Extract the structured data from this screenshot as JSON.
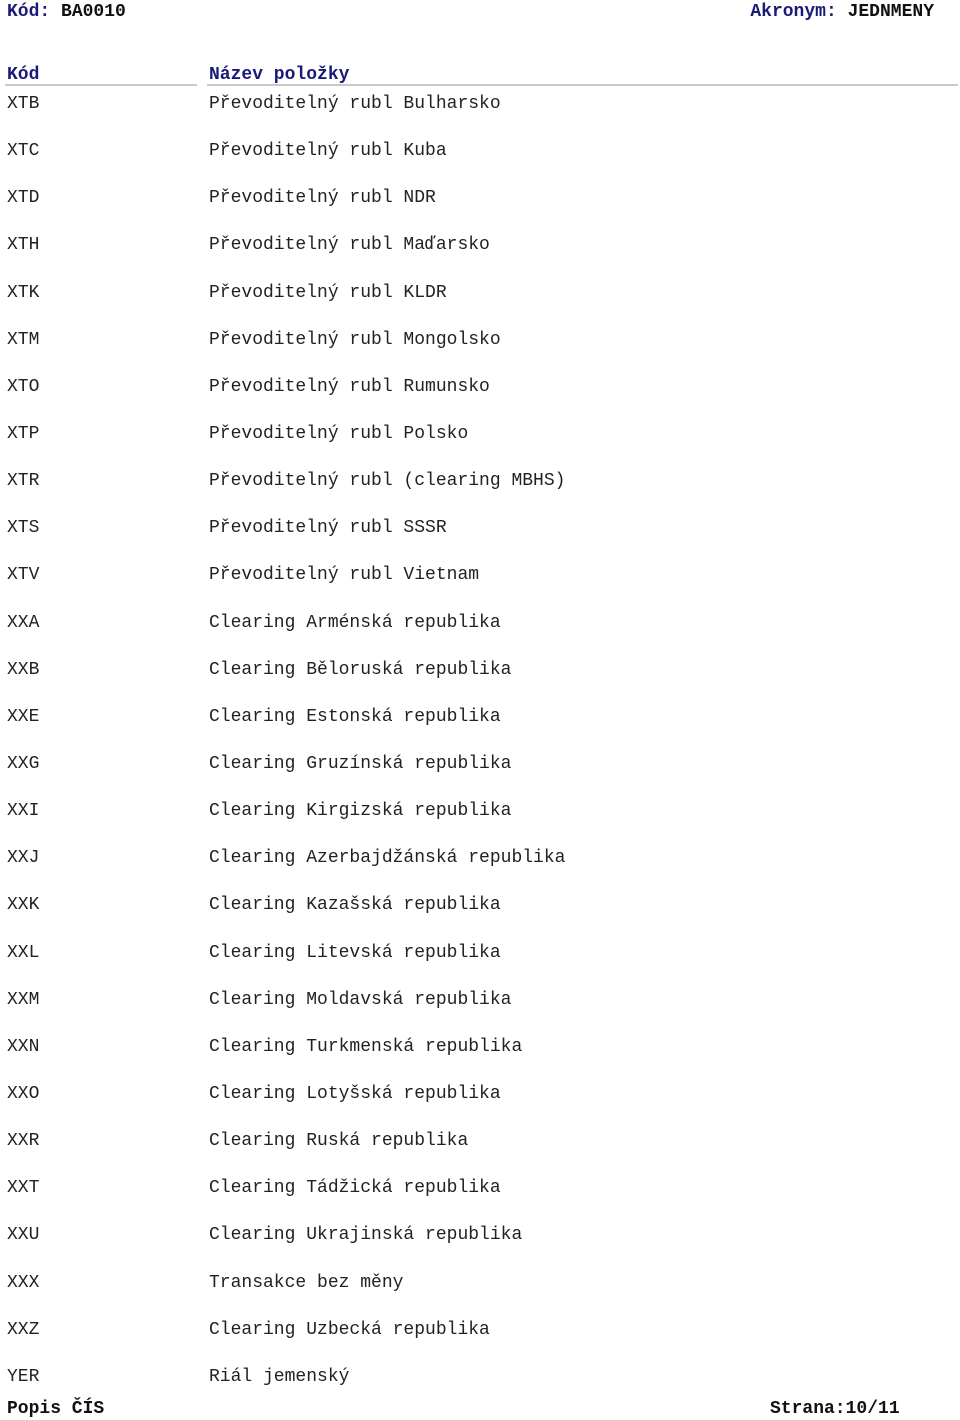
{
  "header": {
    "code_label": "Kód:",
    "code_value": "BA0010",
    "acronym_label": "Akronym:",
    "acronym_value": "JEDNMENY"
  },
  "columns": {
    "code": "Kód",
    "name": "Název položky"
  },
  "rows": [
    {
      "code": "XTB",
      "name": "Převoditelný rubl Bulharsko"
    },
    {
      "code": "XTC",
      "name": "Převoditelný rubl Kuba"
    },
    {
      "code": "XTD",
      "name": "Převoditelný rubl NDR"
    },
    {
      "code": "XTH",
      "name": "Převoditelný rubl Maďarsko"
    },
    {
      "code": "XTK",
      "name": "Převoditelný rubl KLDR"
    },
    {
      "code": "XTM",
      "name": "Převoditelný rubl Mongolsko"
    },
    {
      "code": "XTO",
      "name": "Převoditelný rubl Rumunsko"
    },
    {
      "code": "XTP",
      "name": "Převoditelný rubl Polsko"
    },
    {
      "code": "XTR",
      "name": "Převoditelný rubl (clearing MBHS)"
    },
    {
      "code": "XTS",
      "name": "Převoditelný rubl SSSR"
    },
    {
      "code": "XTV",
      "name": "Převoditelný rubl Vietnam"
    },
    {
      "code": "XXA",
      "name": "Clearing Arménská republika"
    },
    {
      "code": "XXB",
      "name": "Clearing Běloruská republika"
    },
    {
      "code": "XXE",
      "name": "Clearing Estonská republika"
    },
    {
      "code": "XXG",
      "name": "Clearing Gruzínská republika"
    },
    {
      "code": "XXI",
      "name": "Clearing Kirgizská republika"
    },
    {
      "code": "XXJ",
      "name": "Clearing Azerbajdžánská republika"
    },
    {
      "code": "XXK",
      "name": "Clearing Kazašská republika"
    },
    {
      "code": "XXL",
      "name": "Clearing Litevská republika"
    },
    {
      "code": "XXM",
      "name": "Clearing Moldavská republika"
    },
    {
      "code": "XXN",
      "name": "Clearing Turkmenská republika"
    },
    {
      "code": "XXO",
      "name": "Clearing Lotyšská republika"
    },
    {
      "code": "XXR",
      "name": "Clearing Ruská republika"
    },
    {
      "code": "XXT",
      "name": "Clearing Tádžická republika"
    },
    {
      "code": "XXU",
      "name": "Clearing Ukrajinská republika"
    },
    {
      "code": "XXX",
      "name": "Transakce bez měny"
    },
    {
      "code": "XXZ",
      "name": "Clearing Uzbecká republika"
    },
    {
      "code": "YER",
      "name": "Riál jemenský"
    }
  ],
  "footer": {
    "left": "Popis ČÍS",
    "right": "Strana:10/11"
  }
}
